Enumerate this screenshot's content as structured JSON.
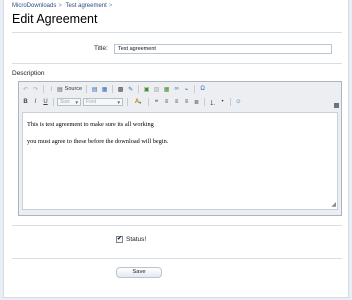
{
  "breadcrumb": {
    "items": [
      "MicroDownloads",
      "Test agreement"
    ],
    "separator": ">"
  },
  "page_title": "Edit Agreement",
  "form": {
    "title_label": "Title:",
    "title_value": "Test agreement",
    "description_label": "Description",
    "status_label": "Status!",
    "status_checked": true,
    "save_label": "Save"
  },
  "editor": {
    "toolbar_row1": [
      {
        "name": "undo-icon",
        "glyph": "↶"
      },
      {
        "name": "redo-icon",
        "glyph": "↷"
      },
      {
        "name": "remove-format-icon",
        "glyph": "Ⅰ"
      },
      {
        "name": "source-button",
        "label": "Source"
      },
      {
        "name": "paste-icon",
        "glyph": "▤"
      },
      {
        "name": "paste-text-icon",
        "glyph": "▦"
      },
      {
        "name": "select-all-icon",
        "glyph": "▩"
      },
      {
        "name": "spellcheck-icon",
        "glyph": "✎"
      },
      {
        "name": "image-icon",
        "glyph": "▣"
      },
      {
        "name": "media-icon",
        "glyph": "▧"
      },
      {
        "name": "table-icon",
        "glyph": "▦"
      },
      {
        "name": "link-icon",
        "glyph": "∞"
      },
      {
        "name": "unlink-icon",
        "glyph": "⌁"
      },
      {
        "name": "special-char-icon",
        "glyph": "Ω"
      }
    ],
    "toolbar_row2": {
      "bold": "B",
      "italic": "I",
      "underline": "U",
      "size_placeholder": "Size",
      "font_placeholder": "Font",
      "text_color_glyph": "A"
    },
    "content": [
      "This is test agreement to make sure its all working",
      "you must agree to these before the download will begin."
    ]
  },
  "colors": {
    "accent": "#2b4f7c",
    "page_background": "#e9eef4"
  }
}
